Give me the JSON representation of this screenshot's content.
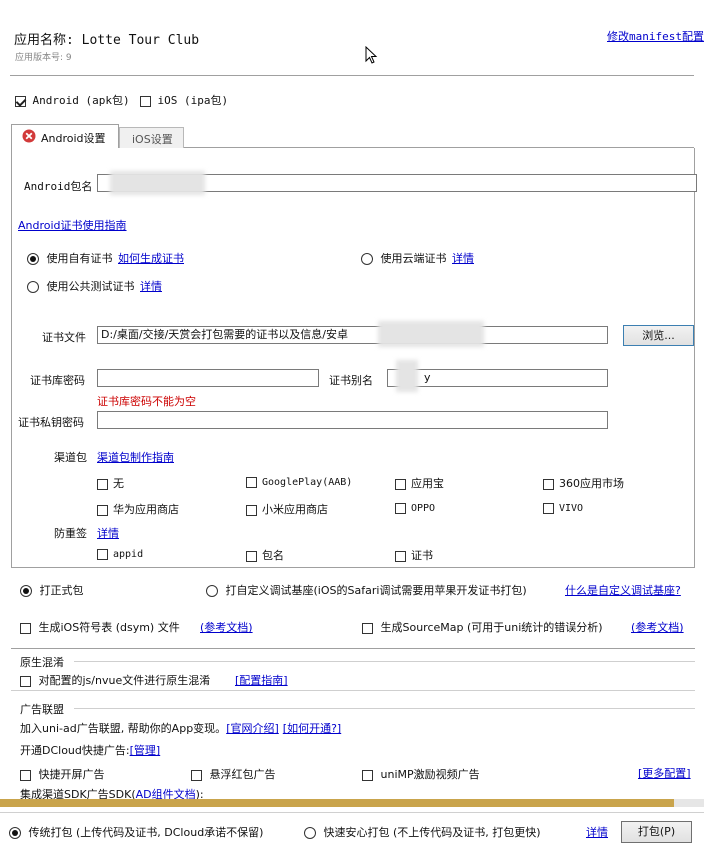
{
  "header": {
    "app_name": "应用名称: Lotte Tour Club",
    "app_version": "应用版本号: 9",
    "edit_manifest": "修改manifest配置"
  },
  "platforms": {
    "android_label": "Android (apk包)",
    "android_checked": true,
    "ios_label": "iOS (ipa包)",
    "ios_checked": false
  },
  "tabs": {
    "android": "Android设置",
    "ios": "iOS设置"
  },
  "android": {
    "package_label": "Android包名",
    "package_value": "",
    "cert_guide_link": "Android证书使用指南",
    "cert_options": {
      "own": "使用自有证书",
      "own_link": "如何生成证书",
      "cloud": "使用云端证书",
      "cloud_link": "详情",
      "public": "使用公共测试证书",
      "public_link": "详情"
    },
    "cert_file_label": "证书文件",
    "cert_file_value": "D:/桌面/交接/天赏会打包需要的证书以及信息/安卓",
    "browse_button": "浏览...",
    "keystore_password_label": "证书库密码",
    "alias_label": "证书别名",
    "alias_value": "y",
    "keystore_error": "证书库密码不能为空",
    "private_key_label": "证书私钥密码",
    "channel_label": "渠道包",
    "channel_link": "渠道包制作指南",
    "channels": [
      "无",
      "GooglePlay(AAB)",
      "应用宝",
      "360应用市场",
      "华为应用商店",
      "小米应用商店",
      "OPPO",
      "VIVO"
    ],
    "anti_label": "防重签",
    "anti_link": "详情",
    "anti_options": [
      "appid",
      "包名",
      "证书"
    ]
  },
  "build_type": {
    "formal": "打正式包",
    "custom": "打自定义调试基座(iOS的Safari调试需要用苹果开发证书打包)",
    "custom_link": "什么是自定义调试基座?"
  },
  "symbols": {
    "dsym": "生成iOS符号表 (dsym) 文件",
    "dsym_link": "(参考文档)",
    "sourcemap": "生成SourceMap (可用于uni统计的错误分析)",
    "sourcemap_link": "(参考文档)"
  },
  "obfuscation": {
    "title": "原生混淆",
    "label": "对配置的js/nvue文件进行原生混淆",
    "link": "[配置指南]"
  },
  "ads": {
    "title": "广告联盟",
    "intro": "加入uni-ad广告联盟, 帮助你的App变现。",
    "intro_link1": "[官网介绍]",
    "intro_link2": "[如何开通?]",
    "dcloud_label": "开通DCloud快捷广告:",
    "dcloud_link": "[管理]",
    "splash": "快捷开屏广告",
    "float": "悬浮红包广告",
    "reward": "uniMP激励视频广告",
    "more_link": "[更多配置]",
    "sdk_label": "集成渠道SDK广告SDK(",
    "sdk_link": "AD组件文档",
    "sdk_suffix": "):"
  },
  "footer": {
    "traditional": "传统打包 (上传代码及证书, DCloud承诺不保留)",
    "safe": "快速安心打包 (不上传代码及证书, 打包更快)",
    "safe_link": "详情",
    "pack_button": "打包(P)"
  }
}
